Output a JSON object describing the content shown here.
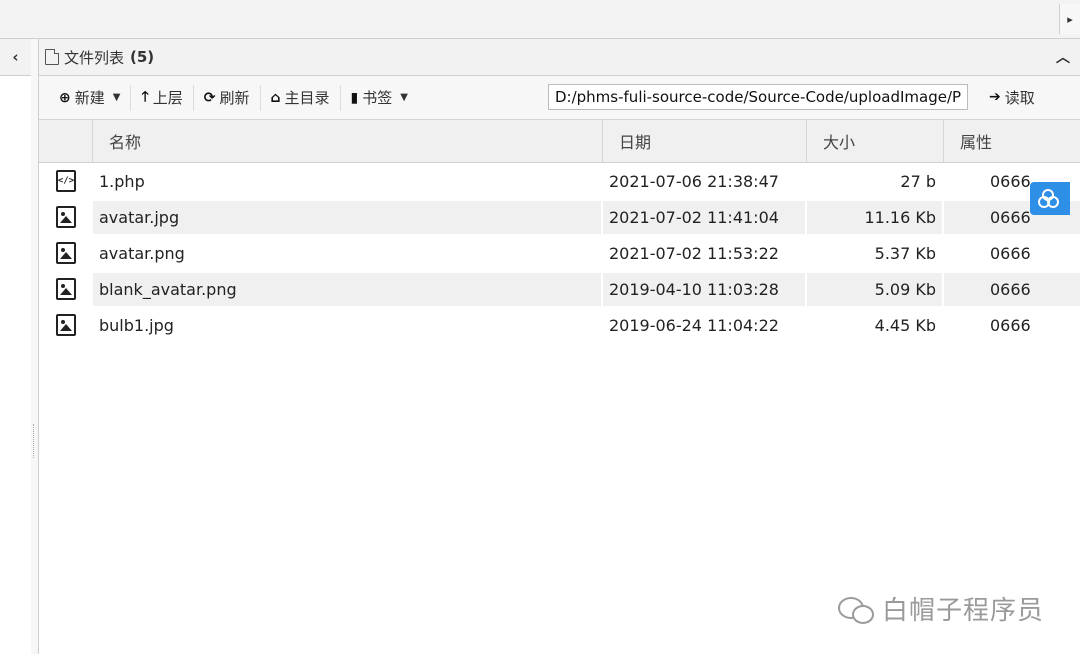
{
  "panel": {
    "title": "文件列表",
    "count": "(5)"
  },
  "toolbar": {
    "new_label": "新建",
    "up_label": "上层",
    "refresh_label": "刷新",
    "home_label": "主目录",
    "bookmark_label": "书签",
    "path_value": "D:/phms-fuli-source-code/Source-Code/uploadImage/Pro",
    "read_label": "读取"
  },
  "table": {
    "headers": {
      "name": "名称",
      "date": "日期",
      "size": "大小",
      "attr": "属性"
    },
    "rows": [
      {
        "name": "1.php",
        "date": "2021-07-06 21:38:47",
        "size": "27 b",
        "attr": "0666",
        "icon": "code-file-icon"
      },
      {
        "name": "avatar.jpg",
        "date": "2021-07-02 11:41:04",
        "size": "11.16 Kb",
        "attr": "0666",
        "icon": "image-file-icon"
      },
      {
        "name": "avatar.png",
        "date": "2021-07-02 11:53:22",
        "size": "5.37 Kb",
        "attr": "0666",
        "icon": "image-file-icon"
      },
      {
        "name": "blank_avatar.png",
        "date": "2019-04-10 11:03:28",
        "size": "5.09 Kb",
        "attr": "0666",
        "icon": "image-file-icon"
      },
      {
        "name": "bulb1.jpg",
        "date": "2019-06-24 11:04:22",
        "size": "4.45 Kb",
        "attr": "0666",
        "icon": "image-file-icon"
      }
    ]
  },
  "watermark": {
    "text": "白帽子程序员"
  },
  "colors": {
    "accent": "#2e8fe6",
    "header_bg": "#f2f2f2",
    "alt_row": "#f0f0f0"
  }
}
